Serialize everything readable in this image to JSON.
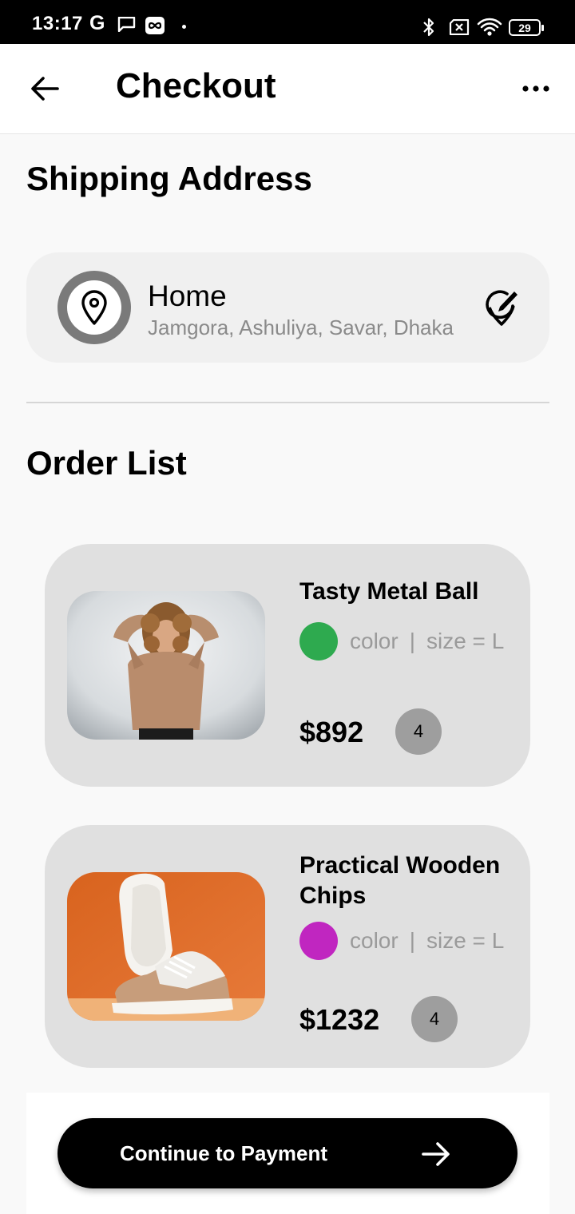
{
  "status_bar": {
    "time": "13:17",
    "g_label": "G",
    "battery": "29",
    "icons": [
      "message-icon",
      "loop-icon",
      "bluetooth-icon",
      "sim-icon",
      "wifi-icon",
      "battery-icon"
    ]
  },
  "app_bar": {
    "title": "Checkout",
    "back_icon": "arrow-left-icon",
    "more_icon": "more-horizontal-icon"
  },
  "shipping": {
    "section_title": "Shipping Address",
    "address": {
      "label": "Home",
      "detail": "Jamgora, Ashuliya, Savar, Dhaka",
      "icon": "location-pin-icon",
      "edit_icon": "edit-location-icon"
    }
  },
  "orders": {
    "section_title": "Order List",
    "items": [
      {
        "name": "Tasty Metal Ball",
        "color_label": "color",
        "separator": "|",
        "size_label": "size = L",
        "swatch_color": "#2eaa4f",
        "price": "$892",
        "quantity": "4",
        "image": "woman-in-sweater-photo"
      },
      {
        "name": "Practical Wooden Chips",
        "color_label": "color",
        "separator": "|",
        "size_label": "size = L",
        "swatch_color": "#c026c0",
        "price": "$1232",
        "quantity": "4",
        "image": "sneakers-photo"
      }
    ]
  },
  "footer": {
    "continue_label": "Continue to Payment",
    "continue_icon": "arrow-right-icon"
  },
  "colors": {
    "primary": "#000000",
    "card_background": "#e0e0e0",
    "address_card_background": "#f0f0f0",
    "secondary_text": "#8a8a8a"
  }
}
